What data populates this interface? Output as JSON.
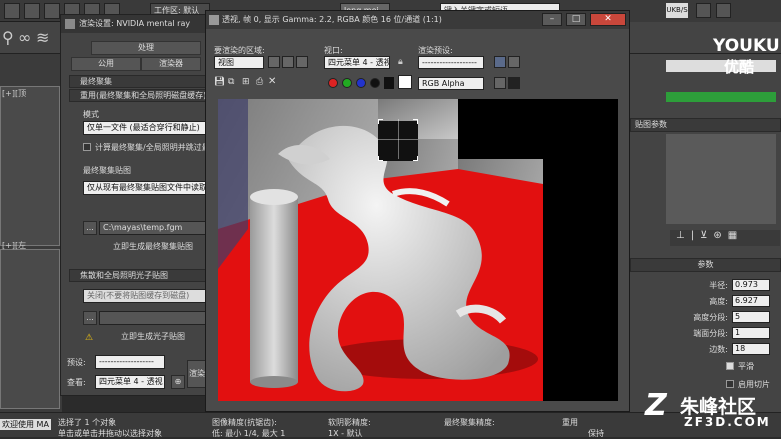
{
  "topbar": {
    "workspace": "工作区: 默认",
    "filename": "long mei",
    "search_placeholder": "键入关键字或短语",
    "right_badge": "UKB/S"
  },
  "render_setup": {
    "title": "渲染设置: NVIDIA mental ray",
    "tabs": [
      "处理",
      "公用",
      "渲染器"
    ],
    "sections": {
      "final_gather_title": "最终聚集",
      "reuse_title": "重用(最终聚集和全局照明磁盘缓存)",
      "photon_title": "焦散和全局照明光子贴图"
    },
    "mode_label": "模式",
    "mode_value": "仅单一文件 (最适合穿行和静止)",
    "calc_checkbox_label": "计算最终聚集/全局照明并跳过最终渲染",
    "fg_map_label": "最终聚集贴图",
    "fg_map_value": "仅从现有最终聚集贴图文件中读取最终",
    "fg_file_path": "C:\\mayas\\temp.fgm",
    "generate_fg_button": "立即生成最终聚集贴图",
    "photon_value": "关闭(不要将贴图缓存到磁盘)",
    "generate_photon_button": "立即生成光子贴图",
    "preset_label": "预设:",
    "preset_value": "-------------------",
    "view_label": "查看:",
    "view_value": "四元菜单 4 - 透视",
    "render_button": "渲染"
  },
  "frame_buffer": {
    "title": "透视, 帧 0, 显示 Gamma: 2.2, RGBA 颜色 16 位/通道 (1:1)",
    "area_label": "要渲染的区域:",
    "area_value": "视图",
    "viewport_label": "视口:",
    "viewport_value": "四元菜单 4 - 透视",
    "preset_label": "渲染预设:",
    "preset_value": "-------------------",
    "channel_value": "RGB Alpha",
    "accent_red": "#cc1111"
  },
  "right_panel": {
    "map_params_title": "贴图参数",
    "params_title": "参数",
    "rows": [
      {
        "label": "半径:",
        "value": "0.973"
      },
      {
        "label": "高度:",
        "value": "6.927"
      },
      {
        "label": "高度分段:",
        "value": "5"
      },
      {
        "label": "端面分段:",
        "value": "1"
      },
      {
        "label": "边数:",
        "value": "18"
      }
    ],
    "smooth_label": "平滑",
    "slice_label": "启用切片"
  },
  "status": {
    "selection": "选择了 1 个对象",
    "hint": "单击或单击并拖动以选择对象",
    "welcome": "欢迎使用 MA",
    "fg_precision_label": "图像精度(抗锯齿):",
    "fg_precision_value": "低: 最小 1/4, 最大 1",
    "soft_shadow_label": "软阴影精度:",
    "soft_shadow_value": "1X - 默认",
    "final_gather_precision_label": "最终聚集精度:",
    "reuse_label": "重用",
    "preserve_label": "保持"
  },
  "watermarks": {
    "youku": "YOUKU",
    "youku_cn": "优酷",
    "site_cn": "朱峰社区",
    "site_url": "ZF3D.COM"
  }
}
